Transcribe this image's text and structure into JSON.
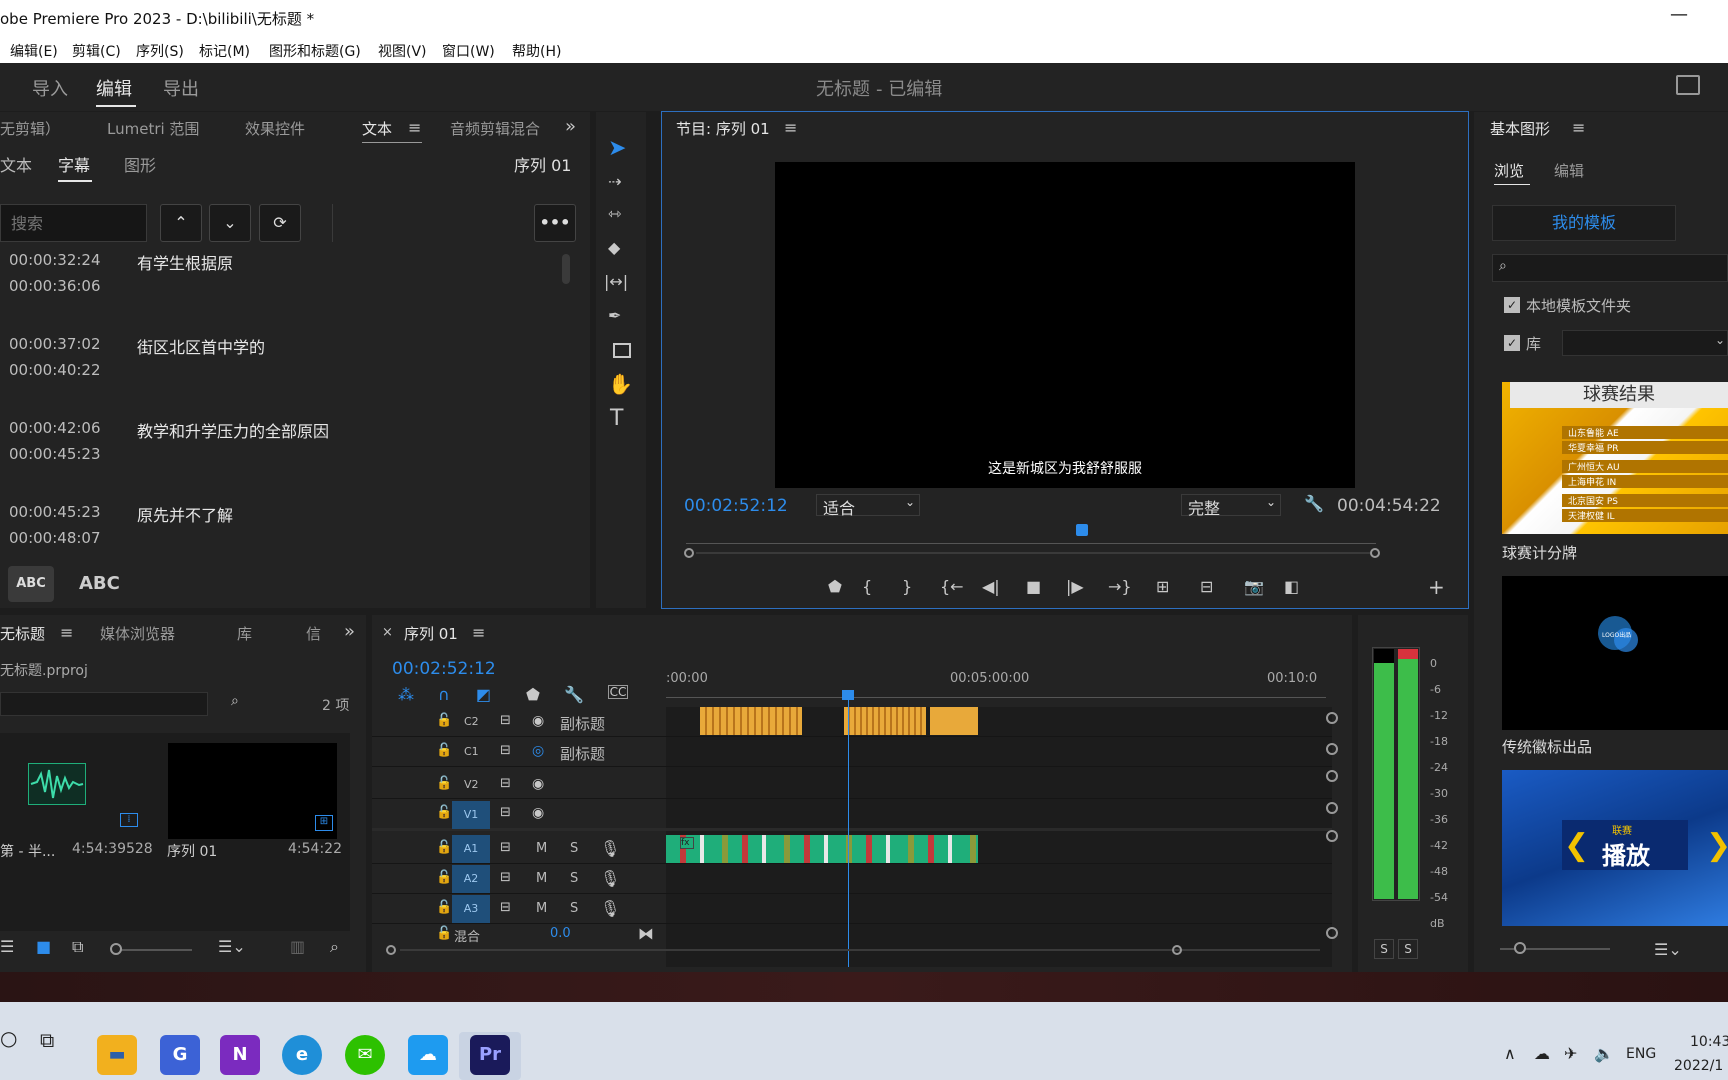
{
  "window": {
    "title": "obe Premiere Pro 2023 - D:\\bilibili\\无标题 *",
    "min": "—"
  },
  "menu": [
    "编辑(E)",
    "剪辑(C)",
    "序列(S)",
    "标记(M)",
    "图形和标题(G)",
    "视图(V)",
    "窗口(W)",
    "帮助(H)"
  ],
  "workspace": {
    "import": "导入",
    "edit": "编辑",
    "export": "导出",
    "project_title": "无标题",
    "project_status": "- 已编辑"
  },
  "text_panel": {
    "tabs": [
      "无剪辑）",
      "Lumetri 范围",
      "效果控件",
      "文本",
      "音频剪辑混合"
    ],
    "subtabs": [
      "文本",
      "字幕",
      "图形"
    ],
    "sequence": "序列 01",
    "search_placeholder": "搜索",
    "captions": [
      {
        "in": "00:00:32:24",
        "out": "00:00:36:06",
        "text": "有学生根据原"
      },
      {
        "in": "00:00:37:02",
        "out": "00:00:40:22",
        "text": "街区北区首中学的"
      },
      {
        "in": "00:00:42:06",
        "out": "00:00:45:23",
        "text": "教学和升学压力的全部原因"
      },
      {
        "in": "00:00:45:23",
        "out": "00:00:48:07",
        "text": "原先并不了解"
      }
    ],
    "abc_small": "ABC",
    "abc_large": "ABC"
  },
  "program": {
    "title": "节目: 序列 01",
    "subtitle": "这是新城区为我舒舒服服",
    "timecode": "00:02:52:12",
    "fit": "适合",
    "quality": "完整",
    "duration": "00:04:54:22",
    "playhead_fraction": 0.574
  },
  "graphics": {
    "title": "基本图形",
    "tab_browse": "浏览",
    "tab_edit": "编辑",
    "my_templates": "我的模板",
    "local_folder": "本地模板文件夹",
    "library": "库",
    "templates": [
      {
        "name": "球赛计分牌",
        "thumb_title": "球赛结果",
        "rows": [
          "山东鲁能 AE",
          "华夏幸福 PR",
          "广州恒大 AU",
          "上海申花 IN",
          "北京国安 PS",
          "天津权健 IL"
        ]
      },
      {
        "name": "传统徽标出品",
        "thumb_text": "LOGO出品"
      },
      {
        "name": "",
        "thumb_small": "联赛",
        "thumb_big": "播放"
      }
    ]
  },
  "project": {
    "tabs": [
      "无标题",
      "媒体浏览器",
      "库",
      "信"
    ],
    "file": "无标题.prproj",
    "count": "2 项",
    "items": [
      {
        "name": "第 - 半...",
        "duration": "4:54:39528"
      },
      {
        "name": "序列 01",
        "duration": "4:54:22"
      }
    ]
  },
  "timeline": {
    "title": "序列 01",
    "timecode": "00:02:52:12",
    "ruler": [
      ":00:00",
      "00:05:00:00",
      "00:10:0"
    ],
    "tracks": [
      {
        "id": "C2",
        "label": "副标题"
      },
      {
        "id": "C1",
        "label": "副标题"
      },
      {
        "id": "V2",
        "label": ""
      },
      {
        "id": "V1",
        "label": ""
      },
      {
        "id": "A1",
        "label": ""
      },
      {
        "id": "A2",
        "label": ""
      },
      {
        "id": "A3",
        "label": ""
      }
    ],
    "mix_label": "混合",
    "mix_value": "0.0",
    "m": "M",
    "s": "S"
  },
  "meter": {
    "scale": [
      "0",
      "-6",
      "-12",
      "-18",
      "-24",
      "-30",
      "-36",
      "-42",
      "-48",
      "-54",
      "dB"
    ],
    "s1": "S",
    "s2": "S"
  },
  "taskbar": {
    "lang": "ENG",
    "time": "10:43",
    "date": "2022/1"
  },
  "colors": {
    "accent": "#2d8ceb",
    "caption_clip": "#e8a93a",
    "audio_clip": "#1fae7a",
    "meter_green": "#3dbd4a"
  }
}
